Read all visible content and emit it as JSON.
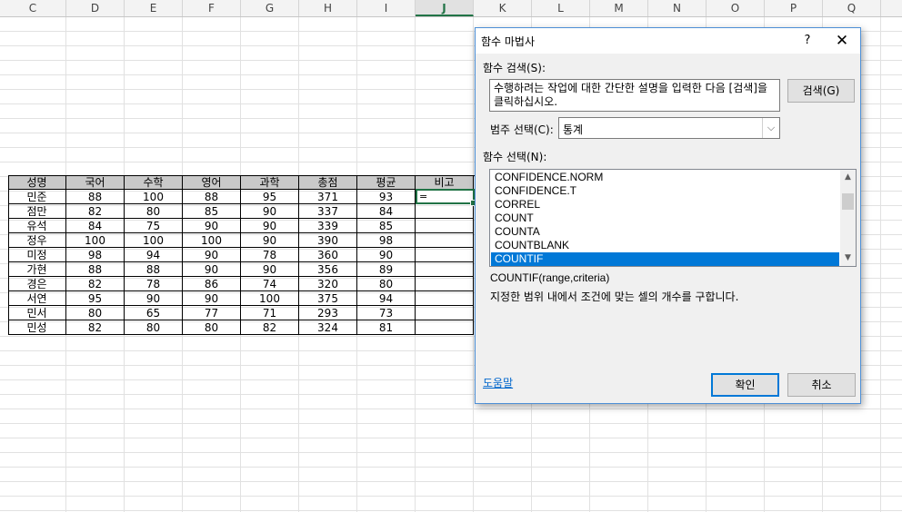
{
  "columns": [
    "C",
    "D",
    "E",
    "F",
    "G",
    "H",
    "I",
    "J",
    "K",
    "L",
    "M",
    "N",
    "O",
    "P",
    "Q"
  ],
  "active_column": "J",
  "table": {
    "headers": [
      "성명",
      "국어",
      "수학",
      "영어",
      "과학",
      "총점",
      "평균",
      "비고"
    ],
    "rows": [
      [
        "민준",
        "88",
        "100",
        "88",
        "95",
        "371",
        "93",
        ""
      ],
      [
        "점만",
        "82",
        "80",
        "85",
        "90",
        "337",
        "84",
        ""
      ],
      [
        "유석",
        "84",
        "75",
        "90",
        "90",
        "339",
        "85",
        ""
      ],
      [
        "정우",
        "100",
        "100",
        "100",
        "90",
        "390",
        "98",
        ""
      ],
      [
        "미정",
        "98",
        "94",
        "90",
        "78",
        "360",
        "90",
        ""
      ],
      [
        "가현",
        "88",
        "88",
        "90",
        "90",
        "356",
        "89",
        ""
      ],
      [
        "경은",
        "82",
        "78",
        "86",
        "74",
        "320",
        "80",
        ""
      ],
      [
        "서연",
        "95",
        "90",
        "90",
        "100",
        "375",
        "94",
        ""
      ],
      [
        "민서",
        "80",
        "65",
        "77",
        "71",
        "293",
        "73",
        ""
      ],
      [
        "민성",
        "82",
        "80",
        "80",
        "82",
        "324",
        "81",
        ""
      ]
    ]
  },
  "active_cell": {
    "value": "="
  },
  "dialog": {
    "title": "함수 마법사",
    "help": "?",
    "close": "✕",
    "search_label": "함수 검색(S):",
    "search_text": "수행하려는 작업에 대한 간단한 설명을 입력한 다음 [검색]을 클릭하십시오.",
    "search_button": "검색(G)",
    "category_label": "범주 선택(C):",
    "category_value": "통계",
    "function_label": "함수 선택(N):",
    "functions": [
      "CONFIDENCE.NORM",
      "CONFIDENCE.T",
      "CORREL",
      "COUNT",
      "COUNTA",
      "COUNTBLANK",
      "COUNTIF"
    ],
    "selected_function": "COUNTIF",
    "syntax": "COUNTIF(range,criteria)",
    "description": "지정한 범위 내에서 조건에 맞는 셀의 개수를 구합니다.",
    "help_link": "도움말",
    "ok_button": "확인",
    "cancel_button": "취소"
  },
  "colors": {
    "accent": "#217346",
    "selection": "#0078d7",
    "header_fill": "#c9c9c9"
  }
}
